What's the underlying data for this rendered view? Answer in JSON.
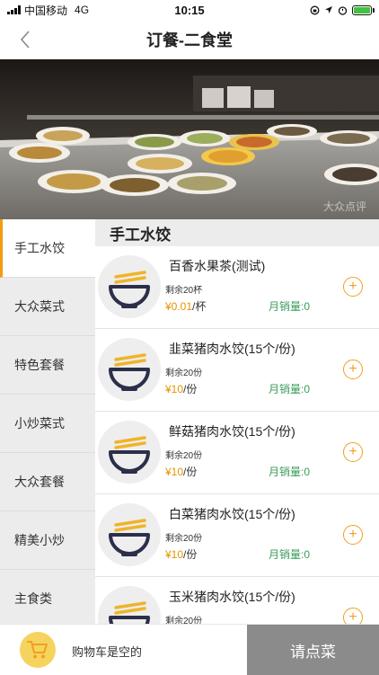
{
  "status_bar": {
    "carrier": "中国移动",
    "network": "4G",
    "time": "10:15"
  },
  "nav": {
    "title": "订餐-二食堂",
    "back_icon": "chevron-left-icon"
  },
  "banner": {
    "watermark": "大众点评"
  },
  "categories": [
    {
      "label": "手工水饺",
      "active": true
    },
    {
      "label": "大众菜式",
      "active": false
    },
    {
      "label": "特色套餐",
      "active": false
    },
    {
      "label": "小炒菜式",
      "active": false
    },
    {
      "label": "大众套餐",
      "active": false
    },
    {
      "label": "精美小炒",
      "active": false
    },
    {
      "label": "主食类",
      "active": false
    }
  ],
  "section": {
    "title": "手工水饺"
  },
  "dishes": [
    {
      "name": "百香水果茶(测试)",
      "stock": "剩余20杯",
      "price": "¥0.01",
      "unit": "/杯",
      "sales": "月销量:0"
    },
    {
      "name": "韭菜猪肉水饺(15个/份)",
      "stock": "剩余20份",
      "price": "¥10",
      "unit": "/份",
      "sales": "月销量:0"
    },
    {
      "name": "鲜菇猪肉水饺(15个/份)",
      "stock": "剩余20份",
      "price": "¥10",
      "unit": "/份",
      "sales": "月销量:0"
    },
    {
      "name": "白菜猪肉水饺(15个/份)",
      "stock": "剩余20份",
      "price": "¥10",
      "unit": "/份",
      "sales": "月销量:0"
    },
    {
      "name": "玉米猪肉水饺(15个/份)",
      "stock": "剩余20份",
      "price": "",
      "unit": "",
      "sales": ""
    }
  ],
  "add_label": "+",
  "cart": {
    "status": "购物车是空的",
    "order_label": "请点菜",
    "icon": "shopping-cart-icon"
  },
  "colors": {
    "accent": "#f39c12",
    "price": "#e69100",
    "sales": "#3a9c5a",
    "order_button": "#8b8b8b",
    "cart_circle": "#f6d35e"
  }
}
